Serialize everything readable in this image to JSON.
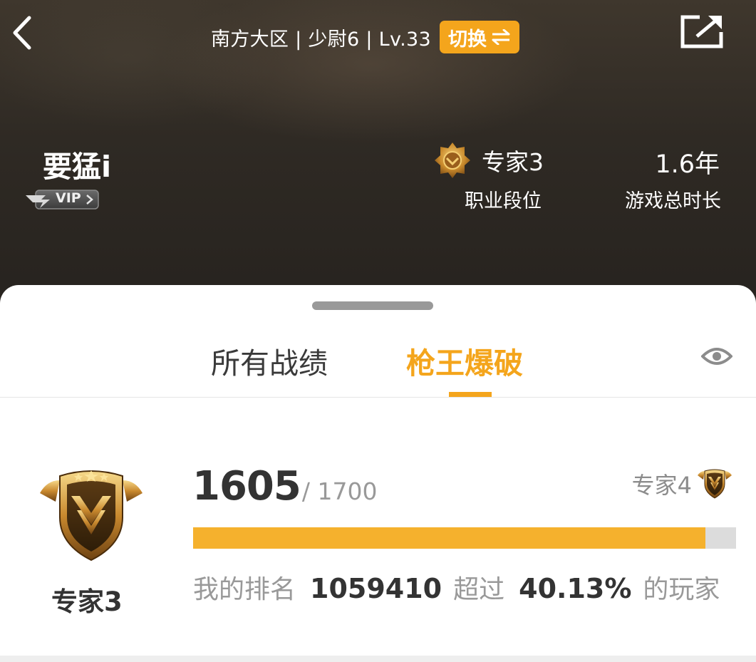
{
  "colors": {
    "accent": "#f4a51c",
    "progress_fill": "#f5b12d",
    "progress_track": "#dcdcdc",
    "header_bg": "#2f2a24"
  },
  "header": {
    "server_info": "南方大区 | 少尉6 | Lv.33",
    "switch_label": "切换",
    "switch_icon": "swap-arrows-icon",
    "back_icon": "chevron-left-icon",
    "share_icon": "share-external-icon"
  },
  "player": {
    "name": "要猛i",
    "vip_label": "VIP"
  },
  "profile_stats": {
    "rank_value": "专家3",
    "rank_label": "职业段位",
    "rank_icon": "rank-medal-icon",
    "playtime_value": "1.6年",
    "playtime_label": "游戏总时长"
  },
  "tabs": [
    {
      "label": "所有战绩",
      "active": false
    },
    {
      "label": "枪王爆破",
      "active": true
    }
  ],
  "visibility_icon": "eye-icon",
  "rank_card": {
    "current_rank": "专家3",
    "score_current": "1605",
    "score_max": "/ 1700",
    "next_rank": "专家4",
    "progress": 0.944,
    "ranking_label": "我的排名",
    "ranking_value": "1059410",
    "exceed_label": "超过",
    "exceed_value": "40.13%",
    "players_label": "的玩家"
  }
}
